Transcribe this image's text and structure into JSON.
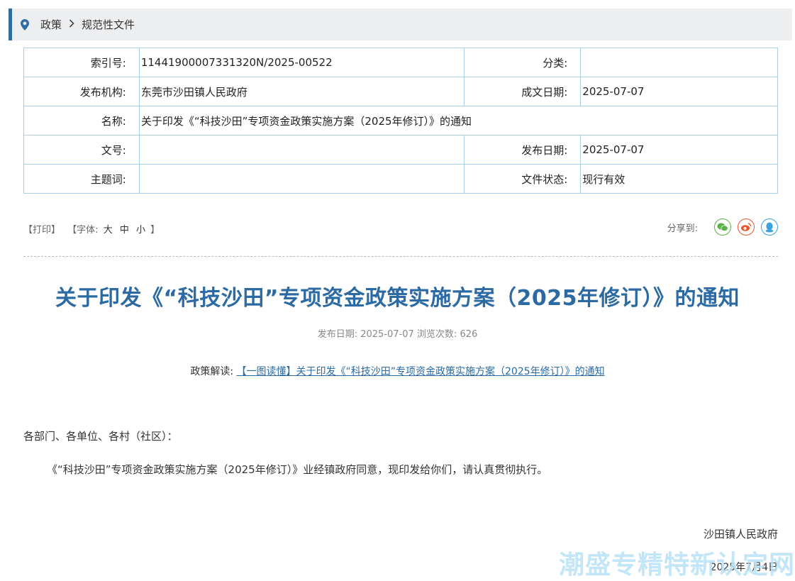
{
  "breadcrumb": {
    "home": "政策",
    "current": "规范性文件"
  },
  "info": {
    "index_label": "索引号:",
    "index_value": "11441900007331320N/2025-00522",
    "category_label": "分类:",
    "category_value": "",
    "publisher_label": "发布机构:",
    "publisher_value": "东莞市沙田镇人民政府",
    "created_label": "成文日期:",
    "created_value": "2025-07-07",
    "name_label": "名称:",
    "name_value": "关于印发《“科技沙田”专项资金政策实施方案（2025年修订）》的通知",
    "docno_label": "文号:",
    "docno_value": "",
    "published_label": "发布日期:",
    "published_value": "2025-07-07",
    "keywords_label": "主题词:",
    "keywords_value": "",
    "status_label": "文件状态:",
    "status_value": "现行有效"
  },
  "tools": {
    "print": "【打印】",
    "font_prefix": "【字体:",
    "large": "大",
    "medium": "中",
    "small": "小",
    "font_suffix": "】"
  },
  "share": {
    "label": "分享到:",
    "wechat_color": "#58b246",
    "weibo_color": "#e6572c",
    "qq_color": "#3ca3dc"
  },
  "article": {
    "title": "关于印发《“科技沙田”专项资金政策实施方案（2025年修订）》的通知",
    "meta": "发布日期: 2025-07-07  浏览次数: 626",
    "reading_label": "政策解读:",
    "reading_link": "【一图读懂】关于印发《“科技沙田”专项资金政策实施方案（2025年修订）》的通知",
    "salutation": "各部门、各单位、各村（社区）：",
    "body": "《“科技沙田”专项资金政策实施方案（2025年修订）》业经镇政府同意，现印发给你们，请认真贯彻执行。",
    "signer": "沙田镇人民政府",
    "date": "2025年7月4日"
  },
  "watermark": "潮盛专精特新认定网",
  "colors": {
    "accent": "#2b6aa3",
    "border": "#a9cfe6"
  }
}
